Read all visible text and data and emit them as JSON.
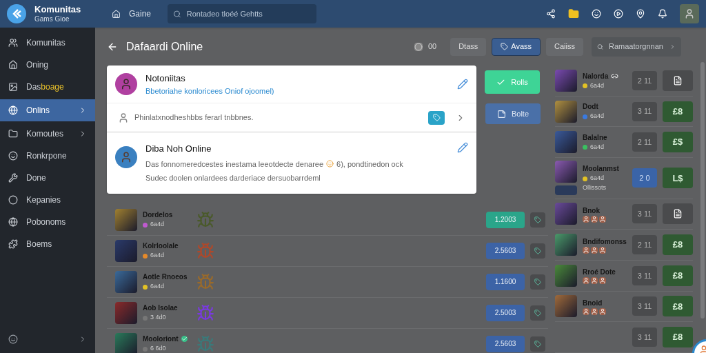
{
  "header": {
    "title": "Komunitas",
    "subtitle": "Gams Gioe",
    "nav_label": "Gaine",
    "search": {
      "placeholder": "Rontadeo tloéé Gehtts"
    }
  },
  "sidebar": {
    "items": [
      {
        "label": "Komunitas",
        "selected": false,
        "chevron": false
      },
      {
        "label": "Oning",
        "selected": false,
        "chevron": false
      },
      {
        "label": "Das",
        "highlight": "boage",
        "selected": false,
        "chevron": false
      },
      {
        "label": "Onlins",
        "selected": true,
        "chevron": true
      },
      {
        "label": "Komoutes",
        "selected": false,
        "chevron": true
      },
      {
        "label": "Ronkrpone",
        "selected": false,
        "chevron": false
      },
      {
        "label": "Done",
        "selected": false,
        "chevron": false
      },
      {
        "label": "Kepanies",
        "selected": false,
        "chevron": false
      },
      {
        "label": "Pobonoms",
        "selected": false,
        "chevron": false
      },
      {
        "label": "Boems",
        "selected": false,
        "chevron": false
      }
    ]
  },
  "page": {
    "title": "Dafaardi Online",
    "badge": "00",
    "tabs": [
      {
        "label": "Dtass",
        "selected": false
      },
      {
        "label": "Avass",
        "selected": true
      },
      {
        "label": "Caiiss",
        "selected": false
      }
    ],
    "search": {
      "placeholder": "Ramaatorgnnan"
    }
  },
  "card": {
    "first": {
      "name": "Notoniitas",
      "subtitle": "Bbetoriahe konloricees Oniof ojoomel)"
    },
    "note": "Phinlatxnodheshbbs ferarl tnbbnes.",
    "second": {
      "name": "Diba Noh Online",
      "desc_start": "Das fonnomeredcestes inestama leeotdecte denaree",
      "desc_end": "6), pondtinedon ock",
      "desc_line2": "Sudec doolen onlardees darderiace dersuobarrdeml"
    }
  },
  "actions": [
    {
      "kind": "confirm",
      "label": "Rolls"
    },
    {
      "kind": "note",
      "label": "Bolte"
    }
  ],
  "games": [
    {
      "name": "Dordelos",
      "meta": "6a4d",
      "color": "#c05ad0",
      "price": {
        "text": "1.2003",
        "color": "#2aa58a"
      },
      "verified": false
    },
    {
      "name": "Kolrloolale",
      "meta": "6a4d",
      "color": "#e58a2a",
      "price": {
        "text": "2.5603",
        "color": "#3c63a6"
      },
      "verified": false
    },
    {
      "name": "Aotle Rnoeos",
      "meta": "6a4d",
      "color": "#e2c225",
      "price": {
        "text": "1.1600",
        "color": "#3c63a6"
      },
      "verified": false
    },
    {
      "name": "Aob Isolae",
      "meta": "3 4d0",
      "color": "#777777",
      "price": {
        "text": "2.5003",
        "color": "#3c63a6"
      },
      "verified": false
    },
    {
      "name": "Mooloriont",
      "meta": "6 6d0",
      "color": "#777777",
      "price": {
        "text": "2.5603",
        "color": "#3c63a6"
      },
      "verified": true
    }
  ],
  "ranking": [
    {
      "kind": "dot",
      "name": "Nalorda",
      "meta": "6a4d",
      "color": "#e2c225",
      "count": "2 11",
      "selected": false,
      "action": {
        "kind": "image"
      },
      "linked": true
    },
    {
      "kind": "dot",
      "name": "Dodt",
      "meta": "6a4d",
      "color": "#3a7ae0",
      "count": "3 11",
      "selected": false,
      "action": {
        "kind": "label",
        "label": "£8"
      },
      "linked": false
    },
    {
      "kind": "dot",
      "name": "Balalne",
      "meta": "6a4d",
      "color": "#3ac060",
      "count": "2 11",
      "selected": false,
      "action": {
        "kind": "label",
        "label": "£$"
      },
      "linked": false
    },
    {
      "kind": "dot",
      "name": "Moolanmst",
      "meta": "6a4d",
      "color": "#e2c225",
      "extra": "Ollissots",
      "count": "2 0",
      "selected": true,
      "action": {
        "kind": "label",
        "label": "L$"
      },
      "linked": false
    },
    {
      "kind": "avatars",
      "name": "Bnok",
      "count": "3 11",
      "selected": false,
      "action": {
        "kind": "image"
      }
    },
    {
      "kind": "avatars",
      "name": "Bndifomonss",
      "count": "2 11",
      "selected": false,
      "action": {
        "kind": "label",
        "label": "£8"
      }
    },
    {
      "kind": "avatars",
      "name": "Rroé Dote",
      "count": "3 11",
      "selected": false,
      "action": {
        "kind": "label",
        "label": "£8"
      }
    },
    {
      "kind": "avatars",
      "name": "Bnoid",
      "count": "3 11",
      "selected": false,
      "action": {
        "kind": "label",
        "label": "£8"
      }
    },
    {
      "kind": "empty",
      "count": "3 11",
      "selected": false,
      "action": {
        "kind": "label",
        "label": "£8"
      }
    }
  ]
}
